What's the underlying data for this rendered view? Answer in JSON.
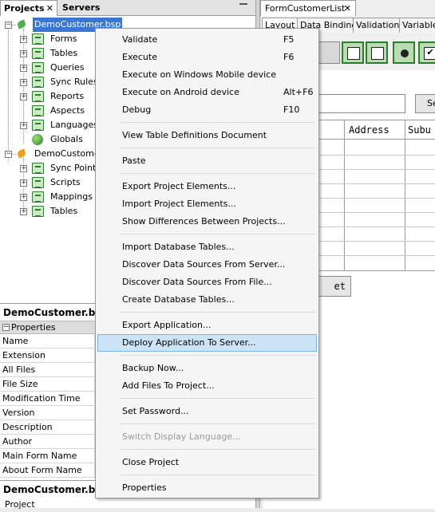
{
  "left_panel": {
    "tabs": [
      {
        "label": "Projects",
        "close": "✕"
      },
      {
        "label": "Servers"
      }
    ],
    "tree": [
      {
        "label": "DemoCustomer.bsp",
        "expander": "−",
        "selected": true
      },
      {
        "label": "Forms",
        "expander": "+"
      },
      {
        "label": "Tables",
        "expander": "+"
      },
      {
        "label": "Queries",
        "expander": "+"
      },
      {
        "label": "Sync Rules",
        "expander": "+"
      },
      {
        "label": "Reports",
        "expander": "+"
      },
      {
        "label": "Aspects"
      },
      {
        "label": "Languages",
        "expander": "+"
      },
      {
        "label": "Globals"
      },
      {
        "label": "DemoCustomer",
        "expander": "−"
      },
      {
        "label": "Sync Points",
        "expander": "+"
      },
      {
        "label": "Scripts",
        "expander": "+"
      },
      {
        "label": "Mappings",
        "expander": "+"
      },
      {
        "label": "Tables",
        "expander": "+"
      }
    ],
    "properties_title": "DemoCustomer.bsp",
    "properties_section": {
      "label": "Properties",
      "expander": "−"
    },
    "property_rows": [
      "Name",
      "Extension",
      "All Files",
      "File Size",
      "Modification Time",
      "Version",
      "Description",
      "Author",
      "Main Form Name",
      "About Form Name"
    ],
    "description_title": "DemoCustomer.bsp",
    "description_text": "Project"
  },
  "right_panel": {
    "doc_tab": {
      "label": "FormCustomerList",
      "close": "✕"
    },
    "sub_tabs": [
      "Layout",
      "Data Binding",
      "Validation",
      "Variables"
    ],
    "search_button_text": "Se",
    "grid_columns": [
      "",
      "Address",
      "Subu"
    ],
    "grid_button_text": "et"
  },
  "context_menu": {
    "groups": [
      [
        {
          "label": "Validate",
          "shortcut": "F5"
        },
        {
          "label": "Execute",
          "shortcut": "F6"
        },
        {
          "label": "Execute on Windows Mobile device",
          "shortcut": ""
        },
        {
          "label": "Execute on Android device",
          "shortcut": "Alt+F6"
        },
        {
          "label": "Debug",
          "shortcut": "F10"
        }
      ],
      [
        {
          "label": "View Table Definitions Document",
          "shortcut": ""
        }
      ],
      [
        {
          "label": "Paste",
          "shortcut": ""
        }
      ],
      [
        {
          "label": "Export Project Elements...",
          "shortcut": ""
        },
        {
          "label": "Import Project Elements...",
          "shortcut": ""
        },
        {
          "label": "Show Differences Between Projects...",
          "shortcut": ""
        }
      ],
      [
        {
          "label": "Import Database Tables...",
          "shortcut": ""
        },
        {
          "label": "Discover Data Sources From Server...",
          "shortcut": ""
        },
        {
          "label": "Discover Data Sources From File...",
          "shortcut": ""
        },
        {
          "label": "Create Database Tables...",
          "shortcut": ""
        }
      ],
      [
        {
          "label": "Export Application...",
          "shortcut": ""
        },
        {
          "label": "Deploy Application To Server...",
          "shortcut": "",
          "highlighted": true
        }
      ],
      [
        {
          "label": "Backup Now...",
          "shortcut": ""
        },
        {
          "label": "Add Files To Project...",
          "shortcut": ""
        }
      ],
      [
        {
          "label": "Set Password...",
          "shortcut": ""
        }
      ],
      [
        {
          "label": "Switch Display Language...",
          "shortcut": "",
          "disabled": true
        }
      ],
      [
        {
          "label": "Close Project",
          "shortcut": ""
        }
      ],
      [
        {
          "label": "Properties",
          "shortcut": ""
        }
      ]
    ]
  },
  "colors": {
    "selection": "#3a77d4",
    "menu_highlight": "#cde4f7",
    "toolbar_green": "#2e7d2e"
  }
}
